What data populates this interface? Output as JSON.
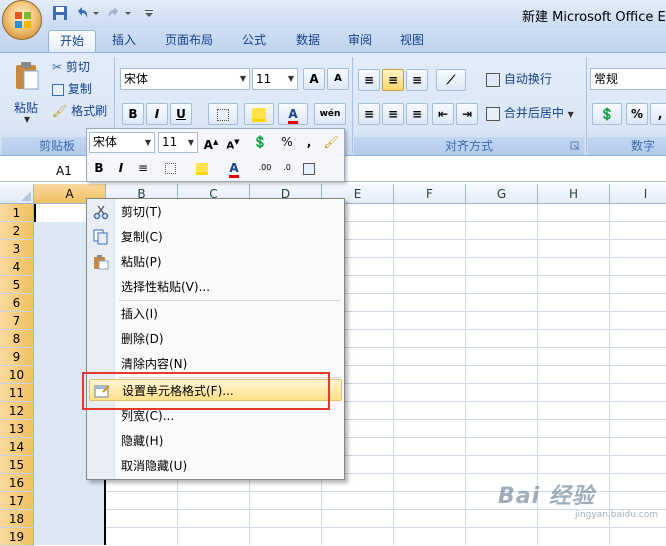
{
  "window": {
    "title": "新建 Microsoft Office Exc"
  },
  "tabs": [
    {
      "label": "开始",
      "active": true
    },
    {
      "label": "插入"
    },
    {
      "label": "页面布局"
    },
    {
      "label": "公式"
    },
    {
      "label": "数据"
    },
    {
      "label": "审阅"
    },
    {
      "label": "视图"
    }
  ],
  "clipboard": {
    "paste_label": "粘贴",
    "cut_label": "剪切",
    "copy_label": "复制",
    "format_painter_label": "格式刷",
    "group_label": "剪贴板"
  },
  "font": {
    "name": "宋体",
    "size": "11",
    "bold": "B",
    "italic": "I",
    "underline": "U",
    "grow": "A",
    "shrink": "A",
    "font_color": "A",
    "phonetic": "wén"
  },
  "alignment": {
    "wrap_text_label": "自动换行",
    "merge_center_label": "合并后居中",
    "group_label": "对齐方式"
  },
  "number": {
    "format": "常规",
    "percent": "%",
    "group_label": "数字"
  },
  "mini_toolbar": {
    "font_name": "宋体",
    "font_size": "11",
    "percent": "%",
    "comma": ","
  },
  "name_box": {
    "value": "A1"
  },
  "columns": [
    "A",
    "B",
    "C",
    "D",
    "E",
    "F",
    "G",
    "H",
    "I"
  ],
  "rows": [
    "1",
    "2",
    "3",
    "4",
    "5",
    "6",
    "7",
    "8",
    "9",
    "10",
    "11",
    "12",
    "13",
    "14",
    "15",
    "16",
    "17",
    "18",
    "19"
  ],
  "context_menu": {
    "cut": "剪切(T)",
    "copy": "复制(C)",
    "paste": "粘贴(P)",
    "paste_special": "选择性粘贴(V)...",
    "insert": "插入(I)",
    "delete": "删除(D)",
    "clear_contents": "清除内容(N)",
    "format_cells": "设置单元格格式(F)...",
    "column_width": "列宽(C)...",
    "hide": "隐藏(H)",
    "unhide": "取消隐藏(U)"
  },
  "watermark": {
    "text": "Bai 经验",
    "url": "jingyan.baidu.com"
  },
  "colors": {
    "accent": "#15428b",
    "highlight": "#ffe08a",
    "red_box": "#e23a2e"
  }
}
